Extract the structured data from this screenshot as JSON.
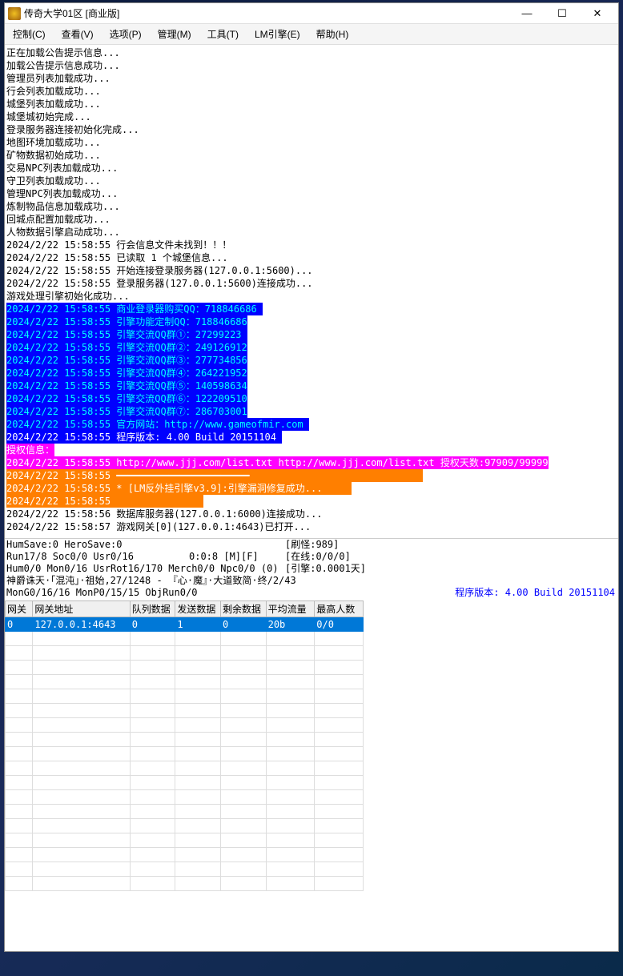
{
  "window": {
    "title": "传奇大学01区  [商业版]"
  },
  "menu": {
    "control": "控制(C)",
    "view": "查看(V)",
    "options": "选项(P)",
    "manage": "管理(M)",
    "tools": "工具(T)",
    "engine": "LM引擎(E)",
    "help": "帮助(H)"
  },
  "log": {
    "init_lines": [
      "正在加载公告提示信息...",
      "加载公告提示信息成功...",
      "管理员列表加载成功...",
      "行会列表加载成功...",
      "城堡列表加载成功...",
      "城堡城初始完成...",
      "登录服务器连接初始化完成...",
      "地图环境加载成功...",
      "矿物数据初始成功...",
      "交易NPC列表加载成功...",
      "守卫列表加载成功...",
      "管理NPC列表加载成功...",
      "炼制物品信息加载成功...",
      "回城点配置加载成功...",
      "人物数据引擎启动成功..."
    ],
    "ts_lines": [
      "2024/2/22 15:58:55 行会信息文件未找到！！！",
      "2024/2/22 15:58:55 已读取 1 个城堡信息...",
      "2024/2/22 15:58:55 开始连接登录服务器(127.0.0.1:5600)...",
      "2024/2/22 15:58:55 登录服务器(127.0.0.1:5600)连接成功...",
      "游戏处理引擎初始化成功..."
    ],
    "blue_lines": [
      "2024/2/22 15:58:55 商业登录器购买QQ：718846686 ",
      "2024/2/22 15:58:55 引擎功能定制QQ：718846686",
      "2024/2/22 15:58:55 引擎交流QQ群①：27299223 ",
      "2024/2/22 15:58:55 引擎交流QQ群②：249126912",
      "2024/2/22 15:58:55 引擎交流QQ群③：277734856",
      "2024/2/22 15:58:55 引擎交流QQ群④：264221952",
      "2024/2/22 15:58:55 引擎交流QQ群⑤：140598634",
      "2024/2/22 15:58:55 引擎交流QQ群⑥：122209510",
      "2024/2/22 15:58:55 引擎交流QQ群⑦：286703001"
    ],
    "blue_site": "2024/2/22 15:58:55 官方网站：http://www.gameofmir.com ",
    "blue_build": "2024/2/22 15:58:55 程序版本: 4.00 Build 20151104 ",
    "magenta1": "授权信息：",
    "magenta2": "2024/2/22 15:58:55 http://www.jjj.com/list.txt http://www.jjj.com/list.txt 授权天数:97909/99999",
    "orange1": "2024/2/22 15:58:55 ━━━━━━━━━━━━━━━━━━━━━━━                              ",
    "orange2": "2024/2/22 15:58:55 * [LM反外挂引擎v3.9]:引擎漏洞修复成功...     ",
    "orange3": "2024/2/22 15:58:55                ",
    "tail_lines": [
      "2024/2/22 15:58:56 数据库服务器(127.0.0.1:6000)连接成功...",
      "2024/2/22 15:58:57 游戏网关[0](127.0.0.1:4643)已打开..."
    ]
  },
  "status": {
    "l1": "HumSave:0 HeroSave:0",
    "l2": "Run17/8 Soc0/0 Usr0/16",
    "l2m": "0:0:8 [M][F]",
    "l3": "Hum0/0 Mon0/16 UsrRot16/170 Merch0/0 Npc0/0 (0)",
    "l4": "神爵诛天·「混沌」·祖始,27/1248 - 『心·魔』·大道致简·终/2/43",
    "l5": "MonG0/16/16 MonP0/15/15 ObjRun0/0",
    "r1": "[刷怪:989]",
    "r2": "[在线:0/0/0]",
    "r3": "[引擎:0.0001天]",
    "ver": "程序版本: 4.00 Build 20151104"
  },
  "table": {
    "headers": [
      "网关",
      "网关地址",
      "队列数据",
      "发送数据",
      "剩余数据",
      "平均流量",
      "最高人数"
    ],
    "row": [
      "0",
      "127.0.0.1:4643",
      "0",
      "1",
      "0",
      "20b",
      "0/0"
    ]
  }
}
